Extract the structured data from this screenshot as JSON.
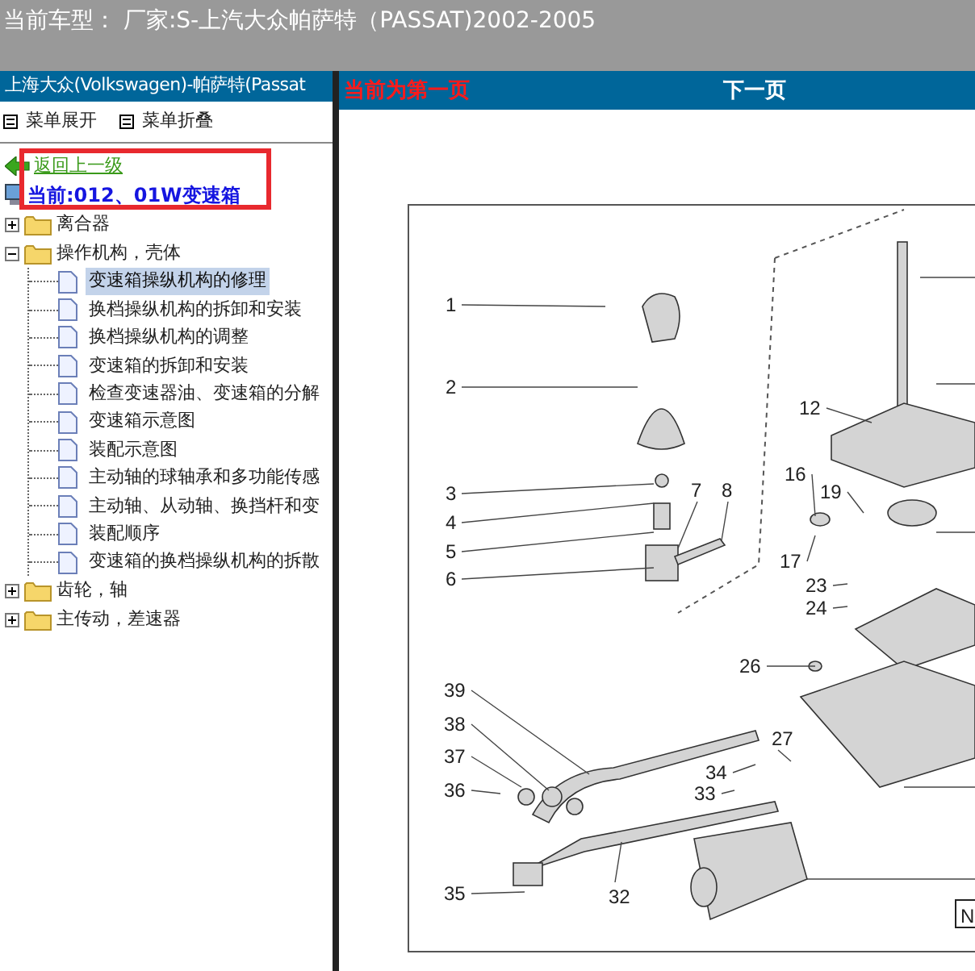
{
  "header": {
    "title": "当前车型： 厂家:S-上汽大众帕萨特（PASSAT)2002-2005"
  },
  "sidebar": {
    "title": "上海大众(Volkswagen)-帕萨特(Passat",
    "menu_buttons": [
      "菜单展开",
      "菜单折叠"
    ],
    "back_link": "返回上一级",
    "current": "当前:012、01W变速箱",
    "tree": [
      {
        "label": "离合器",
        "expanded": false
      },
      {
        "label": "操作机构，壳体",
        "expanded": true,
        "children": [
          {
            "label": "变速箱操纵机构的修理",
            "selected": true
          },
          {
            "label": "换档操纵机构的拆卸和安装",
            "selected": false
          },
          {
            "label": "换档操纵机构的调整",
            "selected": false
          },
          {
            "label": "变速箱的拆卸和安装",
            "selected": false
          },
          {
            "label": "检查变速器油、变速箱的分解",
            "selected": false
          },
          {
            "label": "变速箱示意图",
            "selected": false
          },
          {
            "label": "装配示意图",
            "selected": false
          },
          {
            "label": "主动轴的球轴承和多功能传感",
            "selected": false
          },
          {
            "label": "主动轴、从动轴、换挡杆和变",
            "selected": false
          },
          {
            "label": "装配顺序",
            "selected": false
          },
          {
            "label": "变速箱的换档操纵机构的拆散",
            "selected": false
          }
        ]
      },
      {
        "label": "齿轮，轴",
        "expanded": false
      },
      {
        "label": "主传动，差速器",
        "expanded": false
      }
    ]
  },
  "viewer": {
    "page_status": "当前为第一页",
    "next_page": "下一页",
    "diagram": {
      "callouts": [
        "1",
        "2",
        "12",
        "16",
        "3",
        "7",
        "8",
        "19",
        "4",
        "5",
        "17",
        "6",
        "23",
        "24",
        "26",
        "39",
        "38",
        "27",
        "37",
        "34",
        "36",
        "33",
        "35",
        "32"
      ],
      "corner_label": "N"
    }
  }
}
